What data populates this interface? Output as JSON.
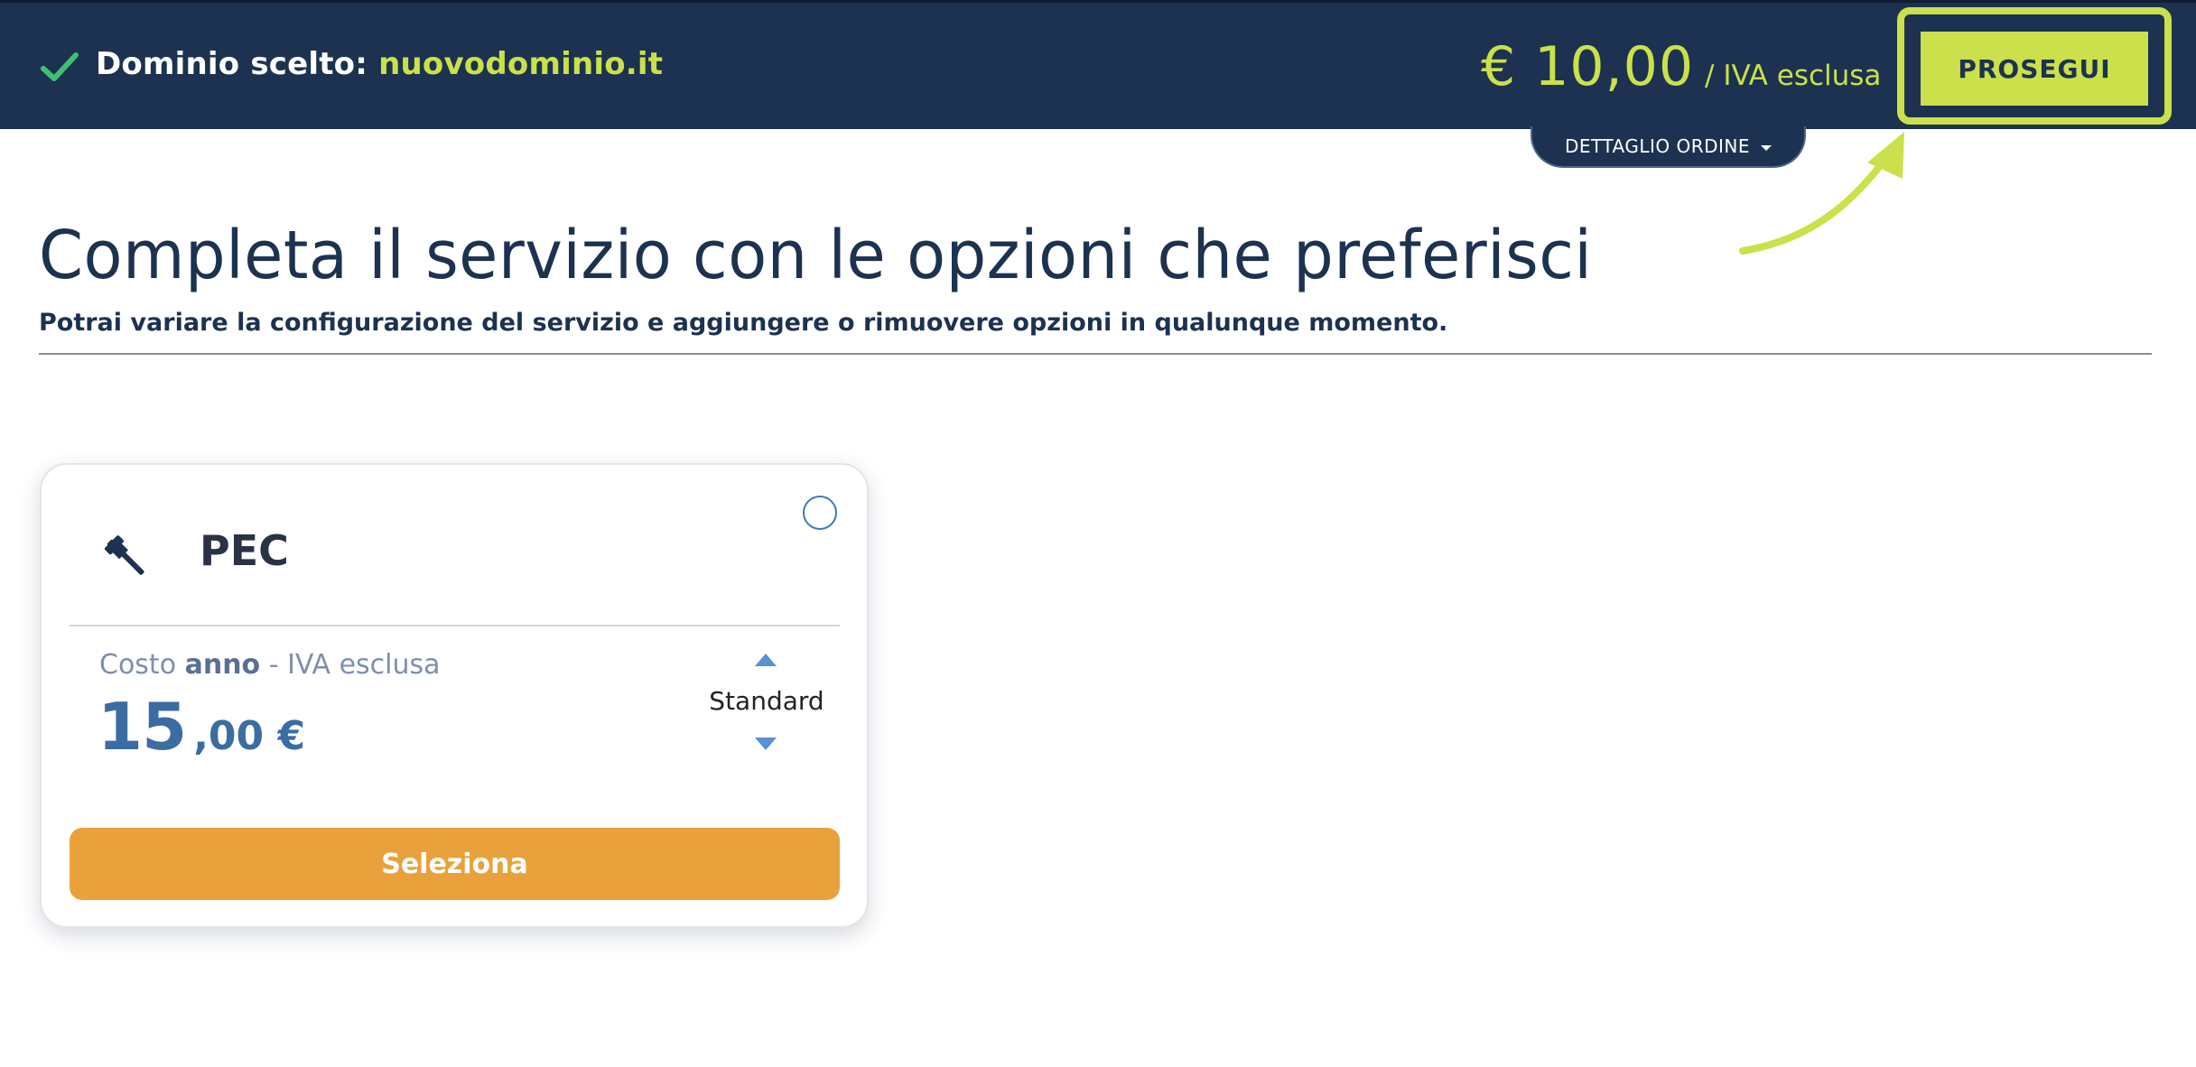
{
  "header": {
    "domain_label": "Dominio scelto: ",
    "domain_value": "nuovodominio.it",
    "price": "€ 10,00",
    "price_suffix": "/ IVA esclusa",
    "continue_label": "PROSEGUI",
    "order_detail_label": "DETTAGLIO ORDINE",
    "icons": {
      "check": "check-icon",
      "order_toggle": "caret-down-icon"
    }
  },
  "main": {
    "title": "Completa il servizio con le opzioni che preferisci",
    "subtitle": "Potrai variare la configurazione del servizio e aggiungere o rimuovere opzioni in qualunque momento."
  },
  "card": {
    "icon": "gavel-icon",
    "title": "PEC",
    "cost_label_prefix": "Costo ",
    "cost_label_period": "anno",
    "cost_label_suffix": " - IVA esclusa",
    "price_integer": "15",
    "price_decimal": ",00 €",
    "plan": "Standard",
    "select_label": "Seleziona",
    "selected": false
  },
  "colors": {
    "header_bg": "#1c3250",
    "accent": "#cbe04a",
    "select_button": "#e9a23b",
    "price_text": "#3b6da3",
    "stepper_arrow": "#5b8fd6"
  }
}
